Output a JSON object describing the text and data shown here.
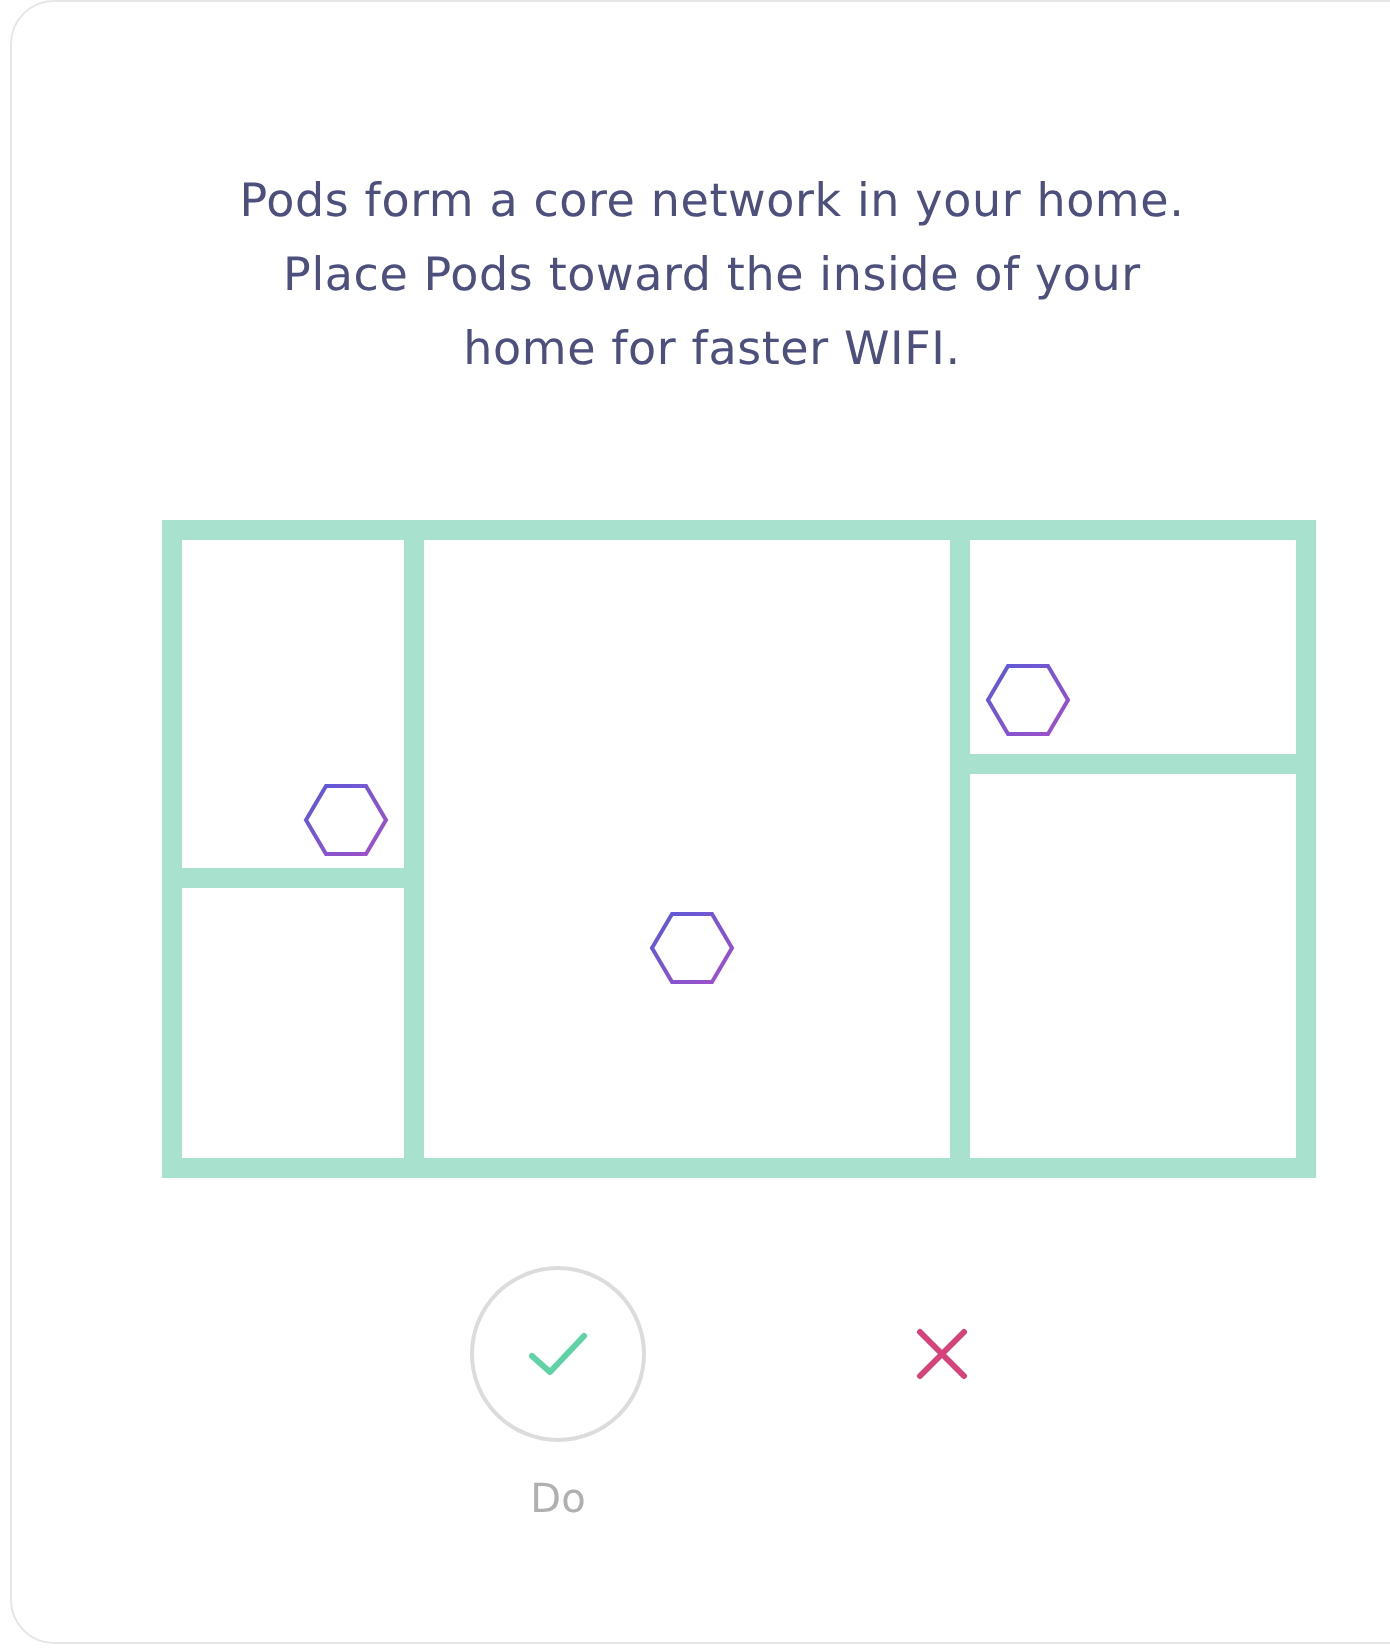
{
  "message": "Pods form a core network in your home.\nPlace Pods toward the inside of your\nhome for faster WIFI.",
  "options": [
    {
      "kind": "do",
      "selected": true,
      "label": "Do"
    },
    {
      "kind": "dont",
      "selected": false
    }
  ]
}
